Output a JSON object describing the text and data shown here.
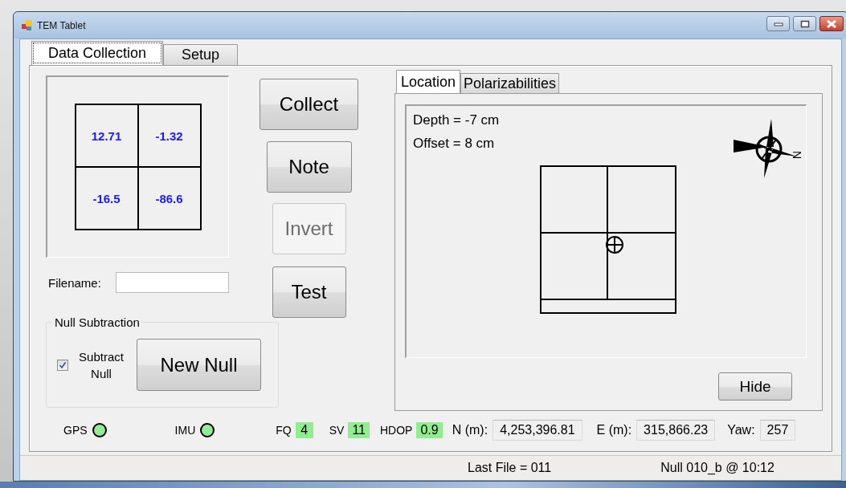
{
  "window": {
    "title": "TEM Tablet"
  },
  "tabs": [
    {
      "label": "Data Collection",
      "selected": true
    },
    {
      "label": "Setup",
      "selected": false
    }
  ],
  "readings": [
    "12.71",
    "-1.32",
    "-16.5",
    "-86.6"
  ],
  "buttons": [
    {
      "label": "Collect",
      "disabled": false
    },
    {
      "label": "Note",
      "disabled": false
    },
    {
      "label": "Invert",
      "disabled": true
    },
    {
      "label": "Test",
      "disabled": false
    }
  ],
  "filename": {
    "label": "Filename:"
  },
  "null_subtraction": {
    "title": "Null Subtraction",
    "checkbox": {
      "label": "Subtract Null",
      "checked": true
    },
    "button": "New Null"
  },
  "location_panel": {
    "tabs": [
      {
        "label": "Location",
        "selected": true
      },
      {
        "label": "Polarizabilities",
        "selected": false
      }
    ],
    "lines": [
      "Depth = -7 cm",
      "Offset = 8 cm"
    ],
    "compass_label": "N",
    "hide_button": "Hide"
  },
  "indicators": [
    {
      "label": "GPS",
      "on": true
    },
    {
      "label": "IMU",
      "on": true
    }
  ],
  "metrics": [
    {
      "label": "FQ",
      "value": "4"
    },
    {
      "label": "SV",
      "value": "11"
    },
    {
      "label": "HDOP",
      "value": "0.9"
    }
  ],
  "coords": [
    {
      "label": "N (m):",
      "value": "4,253,396.81"
    },
    {
      "label": "E (m):",
      "value": "315,866.23"
    },
    {
      "label": "Yaw:",
      "value": "257"
    }
  ],
  "status_bar": [
    "Last File = 011",
    "Null 010_b @ 10:12"
  ]
}
